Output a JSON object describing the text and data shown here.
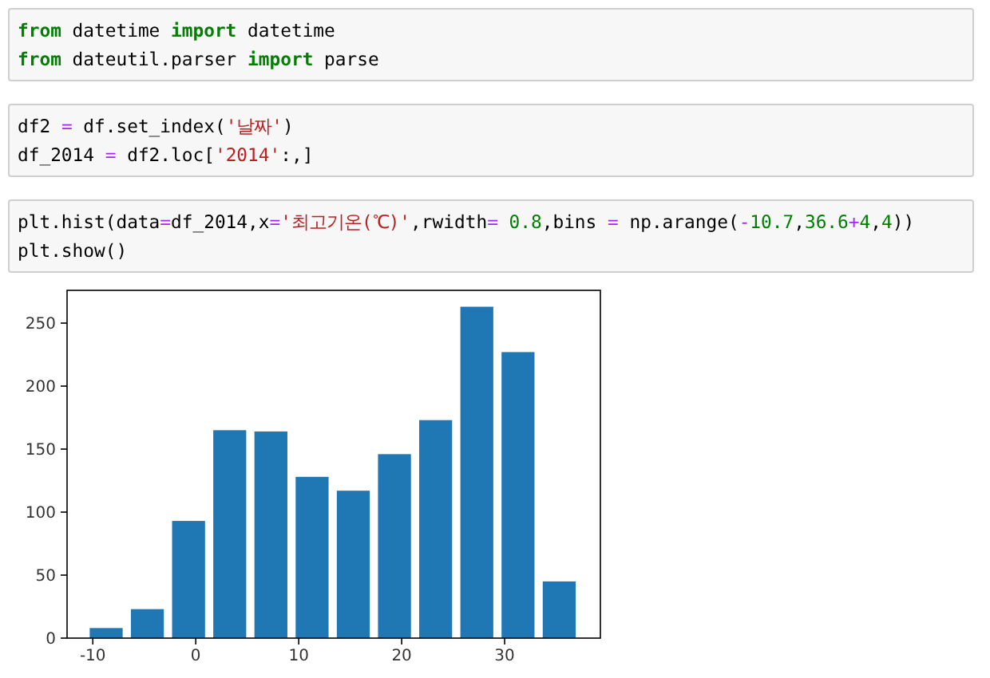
{
  "cells": [
    {
      "lines": [
        [
          {
            "kind": "keyword",
            "text": "from"
          },
          {
            "kind": "plain",
            "text": " datetime "
          },
          {
            "kind": "keyword",
            "text": "import"
          },
          {
            "kind": "plain",
            "text": " datetime"
          }
        ],
        [
          {
            "kind": "keyword",
            "text": "from"
          },
          {
            "kind": "plain",
            "text": " dateutil.parser "
          },
          {
            "kind": "keyword",
            "text": "import"
          },
          {
            "kind": "plain",
            "text": " parse"
          }
        ]
      ]
    },
    {
      "lines": [
        [
          {
            "kind": "plain",
            "text": "df2 "
          },
          {
            "kind": "operator",
            "text": "="
          },
          {
            "kind": "plain",
            "text": " df.set_index("
          },
          {
            "kind": "string",
            "text": "'날짜'"
          },
          {
            "kind": "plain",
            "text": ")"
          }
        ],
        [
          {
            "kind": "plain",
            "text": "df_2014 "
          },
          {
            "kind": "operator",
            "text": "="
          },
          {
            "kind": "plain",
            "text": " df2.loc["
          },
          {
            "kind": "string",
            "text": "'2014'"
          },
          {
            "kind": "plain",
            "text": ":,]"
          }
        ]
      ]
    },
    {
      "lines": [
        [
          {
            "kind": "plain",
            "text": "plt.hist(data"
          },
          {
            "kind": "operator",
            "text": "="
          },
          {
            "kind": "plain",
            "text": "df_2014,x"
          },
          {
            "kind": "operator",
            "text": "="
          },
          {
            "kind": "string",
            "text": "'최고기온(℃)'"
          },
          {
            "kind": "plain",
            "text": ",rwidth"
          },
          {
            "kind": "operator",
            "text": "="
          },
          {
            "kind": "number",
            "text": " 0.8"
          },
          {
            "kind": "plain",
            "text": ",bins "
          },
          {
            "kind": "operator",
            "text": "="
          },
          {
            "kind": "plain",
            "text": " np.arange("
          },
          {
            "kind": "operator",
            "text": "-"
          },
          {
            "kind": "number",
            "text": "10.7"
          },
          {
            "kind": "plain",
            "text": ","
          },
          {
            "kind": "number",
            "text": "36.6"
          },
          {
            "kind": "operator",
            "text": "+"
          },
          {
            "kind": "number",
            "text": "4"
          },
          {
            "kind": "plain",
            "text": ","
          },
          {
            "kind": "number",
            "text": "4"
          },
          {
            "kind": "plain",
            "text": "))"
          }
        ],
        [
          {
            "kind": "plain",
            "text": "plt.show()"
          }
        ]
      ]
    }
  ],
  "output": {
    "chart_data": {
      "type": "bar",
      "x": [
        -8.7,
        -4.7,
        -0.7,
        3.3,
        7.3,
        11.3,
        15.3,
        19.3,
        23.3,
        27.3,
        31.3,
        35.3
      ],
      "series": [
        {
          "color": "#1f77b4",
          "values": [
            8,
            23,
            93,
            165,
            164,
            128,
            117,
            146,
            173,
            263,
            227,
            45
          ]
        }
      ],
      "xlim": [
        -12.5,
        39.3
      ],
      "ylim": [
        0,
        276
      ],
      "xticks": [
        -10,
        0,
        10,
        20,
        30
      ],
      "yticks": [
        0,
        50,
        100,
        150,
        200,
        250
      ]
    }
  }
}
